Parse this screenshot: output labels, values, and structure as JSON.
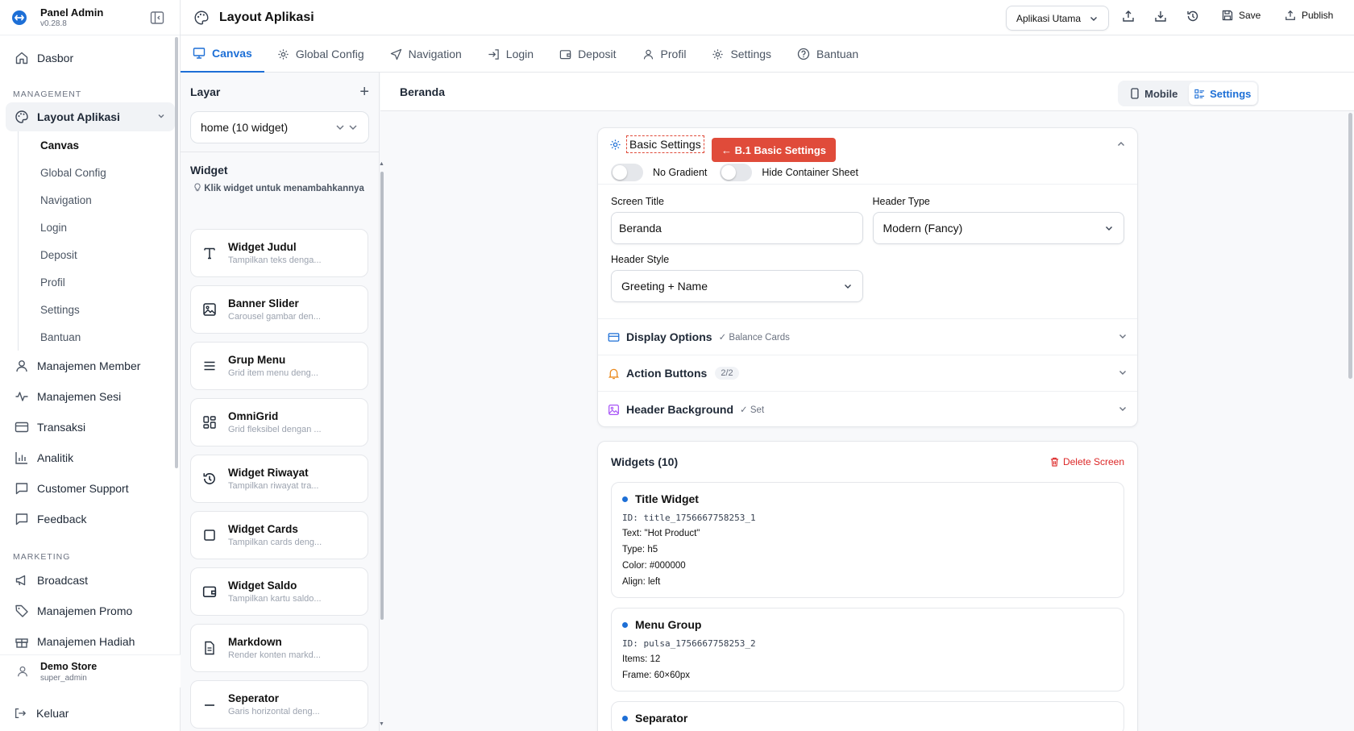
{
  "brand": {
    "name": "Panel Admin",
    "version": "v0.28.8"
  },
  "sidebar": {
    "dashboard": "Dasbor",
    "section_management": "MANAGEMENT",
    "layout_label": "Layout Aplikasi",
    "layout_sub": [
      "Canvas",
      "Global Config",
      "Navigation",
      "Login",
      "Deposit",
      "Profil",
      "Settings",
      "Bantuan"
    ],
    "items_mgmt": [
      "Manajemen Member",
      "Manajemen Sesi",
      "Transaksi",
      "Analitik",
      "Customer Support",
      "Feedback"
    ],
    "section_marketing": "MARKETING",
    "items_mkt": [
      "Broadcast",
      "Manajemen Promo",
      "Manajemen Hadiah"
    ],
    "user": {
      "name": "Demo Store",
      "role": "super_admin"
    },
    "logout": "Keluar"
  },
  "topbar": {
    "title": "Layout Aplikasi",
    "app_select": "Aplikasi Utama",
    "save": "Save",
    "publish": "Publish"
  },
  "tabs": [
    "Canvas",
    "Global Config",
    "Navigation",
    "Login",
    "Deposit",
    "Profil",
    "Settings",
    "Bantuan"
  ],
  "layers": {
    "title": "Layar",
    "screen": "home (10 widget)",
    "widget_title": "Widget",
    "hint": "Klik widget untuk menambahkannya",
    "widgets": [
      {
        "name": "Widget Judul",
        "desc": "Tampilkan teks denga...",
        "icon": "text-icon"
      },
      {
        "name": "Banner Slider",
        "desc": "Carousel gambar den...",
        "icon": "image-icon"
      },
      {
        "name": "Grup Menu",
        "desc": "Grid item menu deng...",
        "icon": "menu-icon"
      },
      {
        "name": "OmniGrid",
        "desc": "Grid fleksibel dengan ...",
        "icon": "grid-icon"
      },
      {
        "name": "Widget Riwayat",
        "desc": "Tampilkan riwayat tra...",
        "icon": "history-icon"
      },
      {
        "name": "Widget Cards",
        "desc": "Tampilkan cards deng...",
        "icon": "card-icon"
      },
      {
        "name": "Widget Saldo",
        "desc": "Tampilkan kartu saldo...",
        "icon": "wallet-icon"
      },
      {
        "name": "Markdown",
        "desc": "Render konten markd...",
        "icon": "document-icon"
      },
      {
        "name": "Seperator",
        "desc": "Garis horizontal deng...",
        "icon": "separator-icon"
      }
    ]
  },
  "main": {
    "screen_name": "Beranda",
    "view_mobile": "Mobile",
    "view_settings": "Settings",
    "basic": {
      "title": "Basic Settings",
      "callout": "← B.1 Basic Settings",
      "no_gradient": "No Gradient",
      "hide_sheet": "Hide Container Sheet",
      "screen_title_label": "Screen Title",
      "screen_title_value": "Beranda",
      "header_type_label": "Header Type",
      "header_type_value": "Modern (Fancy)",
      "header_style_label": "Header Style",
      "header_style_value": "Greeting + Name"
    },
    "accordions": [
      {
        "title": "Display Options",
        "sub": "✓ Balance Cards"
      },
      {
        "title": "Action Buttons",
        "badge": "2/2"
      },
      {
        "title": "Header Background",
        "sub": "✓ Set"
      }
    ],
    "widgets_title": "Widgets (10)",
    "delete_screen": "Delete Screen",
    "widget_items": [
      {
        "title": "Title Widget",
        "id": "ID: title_1756667758253_1",
        "lines": [
          "Text: \"Hot Product\"",
          "Type: h5",
          "Color: #000000",
          "Align: left"
        ]
      },
      {
        "title": "Menu Group",
        "id": "ID: pulsa_1756667758253_2",
        "lines": [
          "Items: 12",
          "Frame: 60×60px"
        ]
      },
      {
        "title": "Separator"
      }
    ]
  },
  "colors": {
    "accent": "#1d6fd6",
    "callout": "#e04b3a",
    "danger": "#dc2626"
  }
}
